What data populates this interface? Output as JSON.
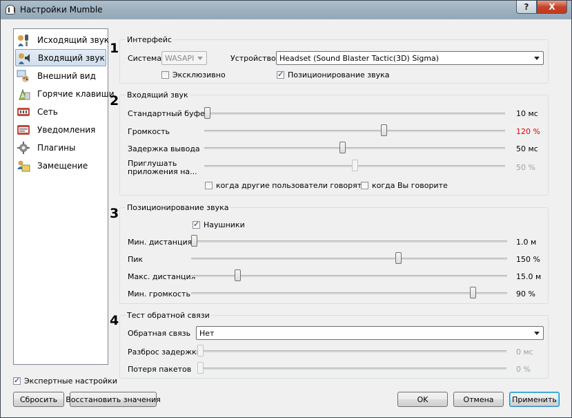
{
  "window": {
    "title": "Настройки Mumble",
    "help_label": "?",
    "close_label": "X"
  },
  "sidebar": {
    "items": [
      {
        "label": "Исходящий звук",
        "icon": "microphone-icon"
      },
      {
        "label": "Входящий звук",
        "icon": "speaker-icon"
      },
      {
        "label": "Внешний вид",
        "icon": "palette-icon"
      },
      {
        "label": "Горячие клавиши",
        "icon": "keyboard-icon"
      },
      {
        "label": "Сеть",
        "icon": "network-icon"
      },
      {
        "label": "Уведомления",
        "icon": "notification-icon"
      },
      {
        "label": "Плагины",
        "icon": "plugin-icon"
      },
      {
        "label": "Замещение",
        "icon": "overlay-icon"
      }
    ],
    "selected": "Входящий звук"
  },
  "expert_settings": {
    "label": "Экспертные настройки",
    "checked": true
  },
  "numbers": [
    "1",
    "2",
    "3",
    "4"
  ],
  "interface": {
    "title": "Интерфейс",
    "system_label": "Система",
    "system_value": "WASAPI",
    "device_label": "Устройство",
    "device_value": "Headset (Sound Blaster Tactic(3D) Sigma)",
    "exclusive_label": "Эксклюзивно",
    "exclusive_checked": false,
    "positional_label": "Позиционирование звука",
    "positional_checked": true
  },
  "incoming": {
    "title": "Входящий звук",
    "buffer_label": "Стандартный буфер",
    "buffer_value": "10 мс",
    "buffer_level": 0.0,
    "volume_label": "Громкость",
    "volume_value": "120 %",
    "volume_level": 0.6,
    "volume_color": "#e00000",
    "delay_label": "Задержка вывода",
    "delay_value": "50 мс",
    "delay_level": 0.46,
    "attenuate_label_1": "Приглушать",
    "attenuate_label_2": "приложения на...",
    "attenuate_value": "50 %",
    "attenuate_level": 0.5,
    "others_talk_label": "когда другие пользователи говорят",
    "others_talk_checked": false,
    "you_talk_label": "когда Вы говорите",
    "you_talk_checked": false
  },
  "positional": {
    "title": "Позиционирование звука",
    "headphones_label": "Наушники",
    "headphones_checked": true,
    "min_distance_label": "Мин. дистанция",
    "min_distance_value": "1.0 м",
    "min_distance_level": 0.0,
    "bloom_label": "Пик",
    "bloom_value": "150 %",
    "bloom_level": 0.66,
    "max_distance_label": "Макс. дистанция",
    "max_distance_value": "15.0 м",
    "max_distance_level": 0.14,
    "min_volume_label": "Мин. громкость",
    "min_volume_value": "90 %",
    "min_volume_level": 0.9
  },
  "loopback": {
    "title": "Тест обратной связи",
    "mode_label": "Обратная связь",
    "mode_value": "Нет",
    "delay_variance_label": "Разброс задержки",
    "delay_variance_value": "0 мс",
    "delay_variance_level": 0.0,
    "packet_loss_label": "Потеря пакетов",
    "packet_loss_value": "0 %",
    "packet_loss_level": 0.0
  },
  "buttons": {
    "reset": "Сбросить",
    "restore": "Восстановить значения",
    "ok": "OK",
    "cancel": "Отмена",
    "apply": "Применить"
  }
}
